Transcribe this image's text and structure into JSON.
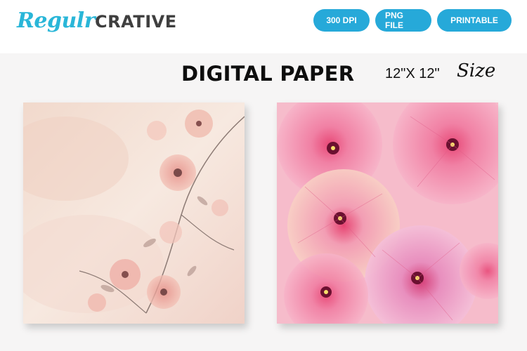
{
  "brand": {
    "script": "Regulr",
    "block": "CRATIVE"
  },
  "badges": [
    "300 DPI",
    "PNG FILE",
    "PRINTABLE"
  ],
  "title": "DIGITAL PAPER",
  "size": {
    "dimensions": "12\"X 12\"",
    "label": "Size"
  },
  "colors": {
    "badge": "#26a9d9",
    "logo_script": "#29b6d8",
    "logo_block": "#3f3f3f"
  }
}
